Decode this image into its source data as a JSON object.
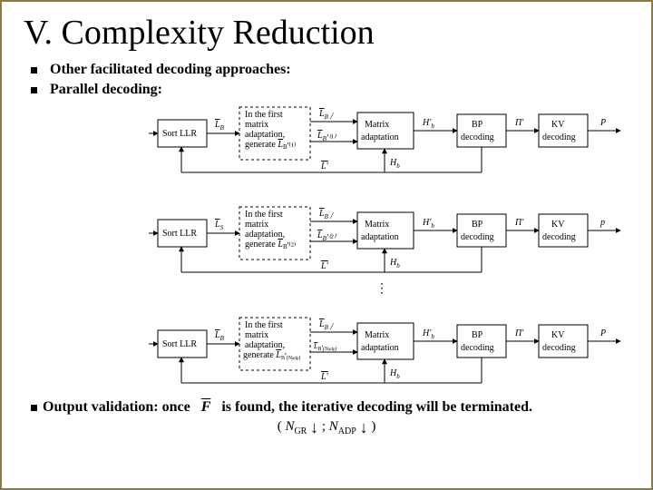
{
  "title": "V. Complexity Reduction",
  "bullets": {
    "b1": "Other facilitated decoding approaches:",
    "b2": "Parallel decoding:"
  },
  "last": {
    "pre": "Output validation: once",
    "mid": "is found, the iterative decoding will be terminated."
  },
  "tick": {
    "open": "(",
    "n1a": "N",
    "n1b": "GR",
    "down1": "↓",
    "sep": ";",
    "n2a": "N",
    "n2b": "ADP",
    "down2": "↓",
    "close": ")"
  },
  "diag": {
    "sort": "Sort LLR",
    "adapt_l1": "In the first",
    "adapt_l2": "matrix",
    "adapt_l3": "adaptation,",
    "gen1": "generate",
    "matrix": "Matrix",
    "adapt": "adaptation",
    "bp": "BP",
    "decoding": "decoding",
    "kv": "KV",
    "L": "L",
    "LB": "L_B",
    "LBp": "L_B'",
    "LBpi": "L_B'(i)",
    "LBpN": "L_B'(N_adp)",
    "Hb": "H_b",
    "Hbp": "H'_b",
    "Pi": "Π",
    "Pip": "Π'",
    "P": "P",
    "p": "p",
    "Ls": "L_S"
  }
}
